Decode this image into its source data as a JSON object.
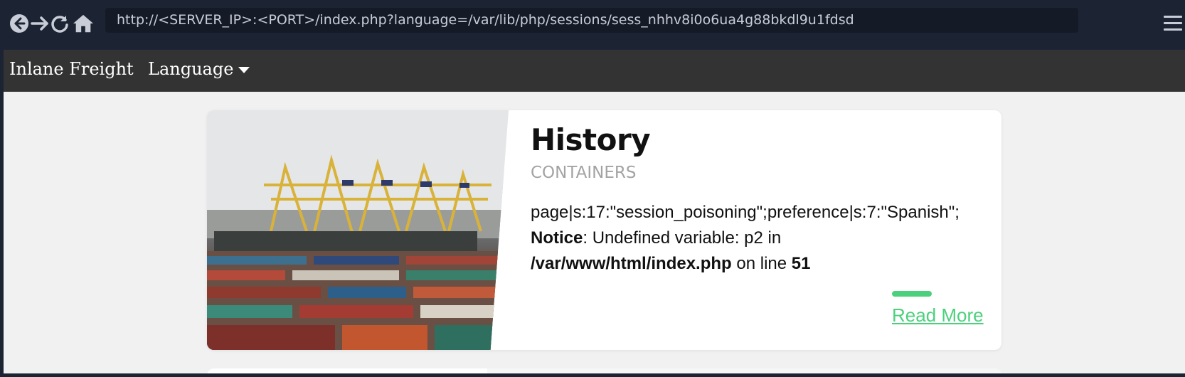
{
  "browser": {
    "url": "http://<SERVER_IP>:<PORT>/index.php?language=/var/lib/php/sessions/sess_nhhv8i0o6ua4g88bkdl9u1fdsd",
    "icons": [
      "back-icon",
      "forward-icon",
      "reload-icon",
      "home-icon",
      "menu-icon"
    ]
  },
  "site_nav": {
    "brand": "Inlane Freight",
    "language_label": "Language"
  },
  "card": {
    "title": "History",
    "subtitle": "CONTAINERS",
    "session_dump": "page|s:17:\"session_poisoning\";preference|s:7:\"Spanish\";",
    "notice_label": "Notice",
    "notice_text": ": Undefined variable: p2 in ",
    "notice_path": "/var/www/html/index.php",
    "notice_on_line": " on line ",
    "notice_line": "51",
    "read_more": "Read More"
  },
  "colors": {
    "browser_bg": "#1c2434",
    "nav_bg": "#333333",
    "page_bg": "#f1f1f1",
    "accent_green": "#4cd07d"
  }
}
